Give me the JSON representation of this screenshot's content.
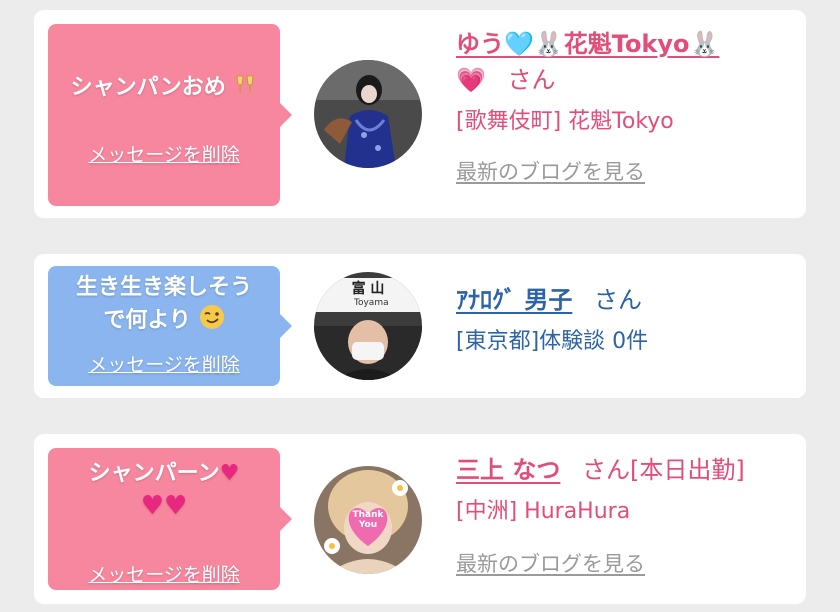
{
  "items": [
    {
      "message": "シャンパンおめ",
      "message_emoji": "champagne-glasses",
      "delete_label": "メッセージを削除",
      "name": "ゆう🩵🐰花魁Tokyo🐰",
      "name_suffix_emoji": "💗",
      "san": "さん",
      "detail": "[歌舞伎町] 花魁Tokyo",
      "blog_link": "最新のブログを見る",
      "color": "#f6879f"
    },
    {
      "message_line1": "生き生き楽しそう",
      "message_line2": "で何より",
      "message_emoji": "winking-face",
      "delete_label": "メッセージを削除",
      "name": "ｱﾅﾛｸﾞ 男子",
      "san": "さん",
      "detail": "[東京都]体験談 0件",
      "avatar_sign_big": "富 山",
      "avatar_sign_small": "Toyama",
      "color": "#8bb5ee"
    },
    {
      "message_line1": "シャンパーン",
      "message_emojis": "heart-icons",
      "delete_label": "メッセージを削除",
      "name": "三上 なつ",
      "san": "さん",
      "status": "[本日出勤]",
      "detail": "[中洲] HuraHura",
      "blog_link": "最新のブログを見る",
      "avatar_sticker": "Thank You",
      "color": "#f6879f"
    }
  ],
  "colors": {
    "pink_text": "#e24d79",
    "blue_text": "#2d64a8",
    "link_gray": "#9a9a9a"
  }
}
